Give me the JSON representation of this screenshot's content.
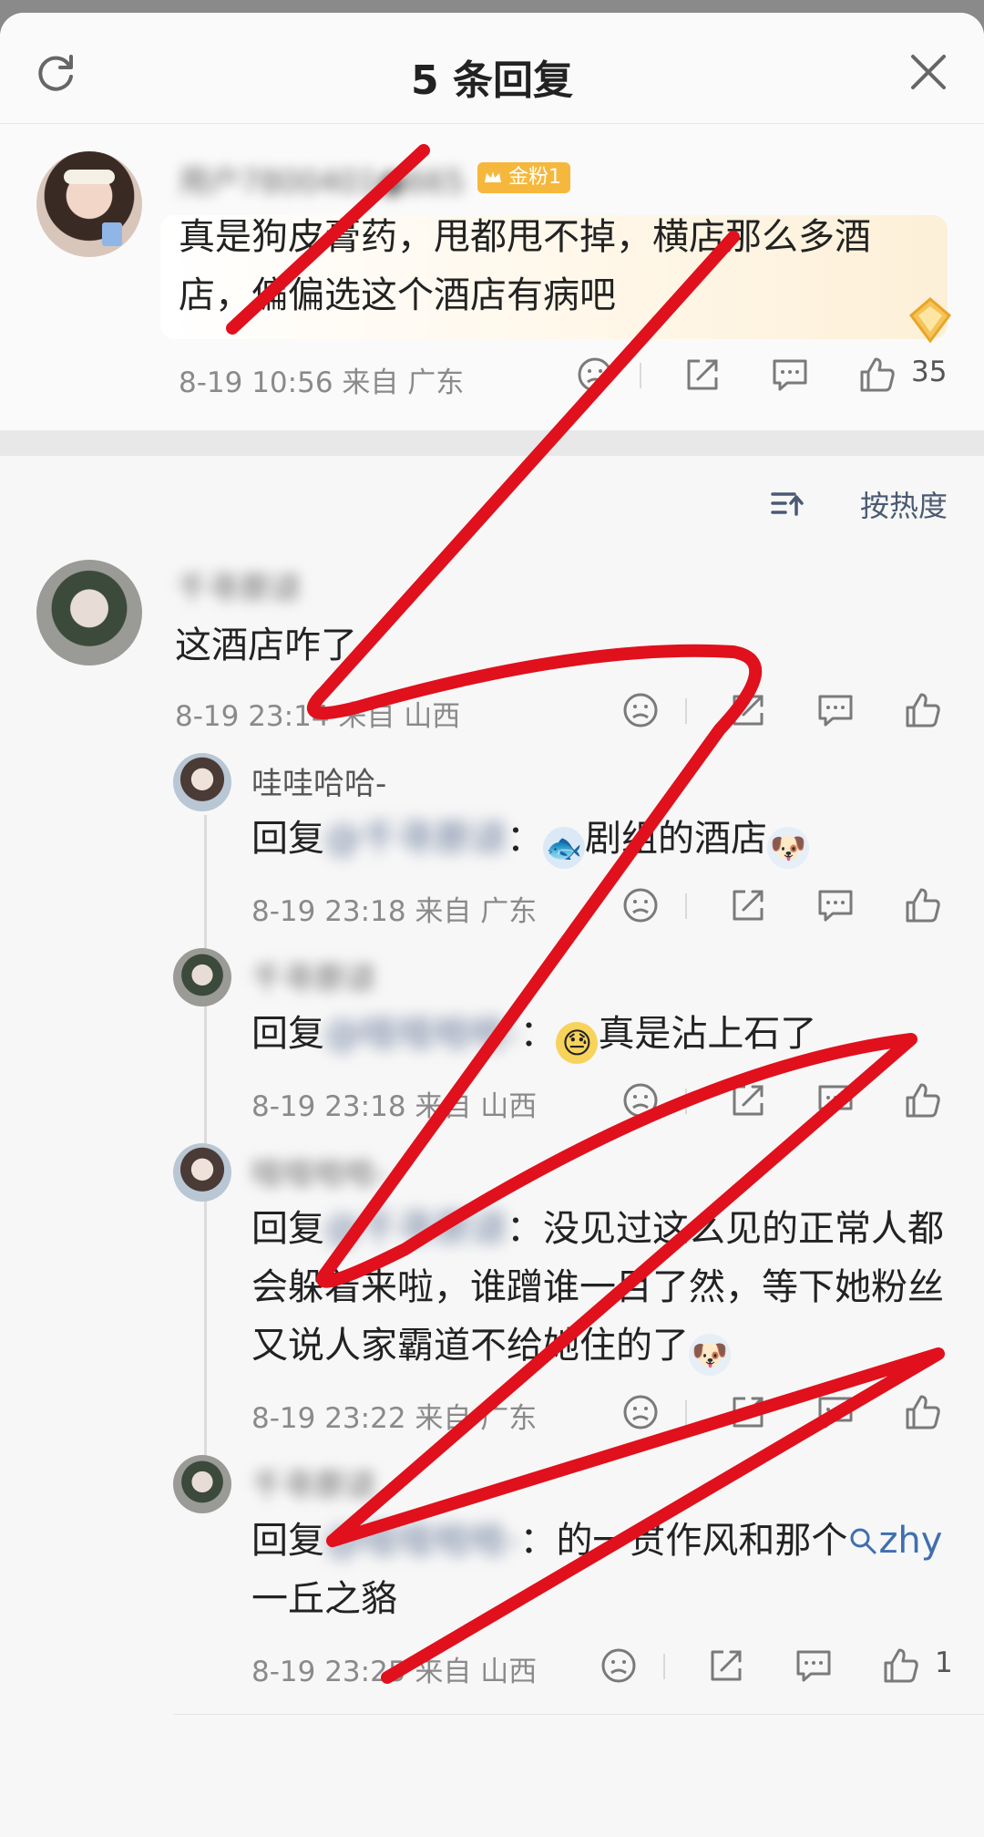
{
  "header": {
    "title": "5 条回复",
    "refresh_icon": "refresh-icon",
    "close_icon": "close-icon"
  },
  "main_comment": {
    "username": "用户7800401●665",
    "badge": "金粉1",
    "text": "真是狗皮膏药，甩都甩不掉，横店那么多酒店，偏偏选这个酒店有病吧",
    "time": "8-19 10:56",
    "location": "来自 广东",
    "likes": "35"
  },
  "sort_label": "按热度",
  "top_reply": {
    "username": "千寻原谅",
    "text": "这酒店咋了",
    "time": "8-19 23:14",
    "location": "来自 山西"
  },
  "replies": [
    {
      "username": "哇哇哈哈-",
      "prefix": "回复",
      "mention": "@千寻原谅",
      "text": "剧组的酒店",
      "time": "8-19 23:18",
      "location": "来自 广东"
    },
    {
      "username": "千寻原谅",
      "prefix": "回复",
      "mention": "@哇哇哈哈-",
      "text": "真是沾上石了",
      "time": "8-19 23:18",
      "location": "来自 山西"
    },
    {
      "username": "哇哇哈哈-",
      "prefix": "回复",
      "mention": "@千寻原谅",
      "text": "没见过这么见的正常人都会躲着来啦，谁蹭谁一目了然，等下她粉丝又说人家霸道不给她住的了",
      "time": "8-19 23:22",
      "location": "来自 广东"
    },
    {
      "username": "千寻原谅",
      "prefix": "回复",
      "mention": "@哇哇哈哈-",
      "text_before": "的一贯作风和那个",
      "topic": "zhy",
      "text_after": "一丘之貉",
      "time": "8-19 23:25",
      "location": "来自 山西",
      "likes": "1"
    }
  ],
  "colors": {
    "accent_red": "#e0101c",
    "badge_gold": "#f5b83d",
    "link_blue": "#3f6fb0"
  }
}
